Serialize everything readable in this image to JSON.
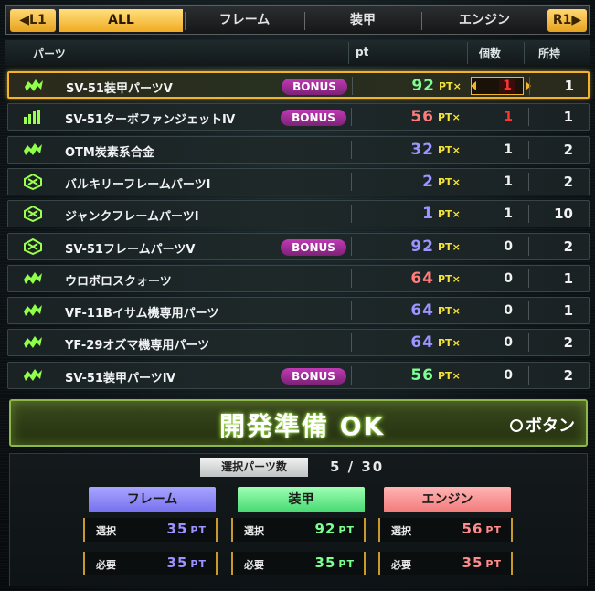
{
  "tabs": {
    "l1": "L1",
    "all": "ALL",
    "frame": "フレーム",
    "armor": "装甲",
    "engine": "エンジン",
    "r1": "R1"
  },
  "columns": {
    "parts": "パーツ",
    "pt": "pt",
    "count": "個数",
    "owned": "所持"
  },
  "pt_suffix": "PT×",
  "bonus_label": "BONUS",
  "parts": [
    {
      "icon": "armor-icon",
      "name": "SV-51装甲パーツⅤ",
      "bonus": true,
      "pt": "92",
      "pt_color": "#7dff92",
      "count": "1",
      "owned": "1",
      "selected": true
    },
    {
      "icon": "engine-icon",
      "name": "SV-51ターボファンジェットⅣ",
      "bonus": true,
      "pt": "56",
      "pt_color": "#ff7c7c",
      "count": "1",
      "count_red": true,
      "owned": "1"
    },
    {
      "icon": "armor-icon",
      "name": "OTM炭素系合金",
      "bonus": false,
      "pt": "32",
      "pt_color": "#9c94ff",
      "count": "1",
      "owned": "2"
    },
    {
      "icon": "frame-icon",
      "name": "バルキリーフレームパーツⅠ",
      "bonus": false,
      "pt": "2",
      "pt_color": "#9c94ff",
      "count": "1",
      "owned": "2"
    },
    {
      "icon": "frame-icon",
      "name": "ジャンクフレームパーツⅠ",
      "bonus": false,
      "pt": "1",
      "pt_color": "#9c94ff",
      "count": "1",
      "owned": "10"
    },
    {
      "icon": "frame-icon",
      "name": "SV-51フレームパーツⅤ",
      "bonus": true,
      "pt": "92",
      "pt_color": "#9c94ff",
      "count": "0",
      "owned": "2"
    },
    {
      "icon": "armor-icon",
      "name": "ウロボロスクォーツ",
      "bonus": false,
      "pt": "64",
      "pt_color": "#ff7c7c",
      "count": "0",
      "owned": "1"
    },
    {
      "icon": "armor-icon",
      "name": "VF-11Bイサム機専用パーツ",
      "bonus": false,
      "pt": "64",
      "pt_color": "#9c94ff",
      "count": "0",
      "owned": "1"
    },
    {
      "icon": "armor-icon",
      "name": "YF-29オズマ機専用パーツ",
      "bonus": false,
      "pt": "64",
      "pt_color": "#9c94ff",
      "count": "0",
      "owned": "2"
    },
    {
      "icon": "armor-icon",
      "name": "SV-51装甲パーツⅣ",
      "bonus": true,
      "pt": "56",
      "pt_color": "#7dff92",
      "count": "0",
      "owned": "2"
    }
  ],
  "ready": {
    "title": "開発準備 OK",
    "button": "ボタン"
  },
  "summary": {
    "selected_label": "選択パーツ数",
    "selected_value": "5 / 30",
    "categories": [
      {
        "name": "フレーム",
        "select_label": "選択",
        "select_value": "35",
        "required_label": "必要",
        "required_value": "35",
        "color": "#9c94ff"
      },
      {
        "name": "装甲",
        "select_label": "選択",
        "select_value": "92",
        "required_label": "必要",
        "required_value": "35",
        "color": "#7dff92"
      },
      {
        "name": "エンジン",
        "select_label": "選択",
        "select_value": "56",
        "required_label": "必要",
        "required_value": "35",
        "color": "#ff8c8c"
      }
    ],
    "unit": "PT"
  }
}
